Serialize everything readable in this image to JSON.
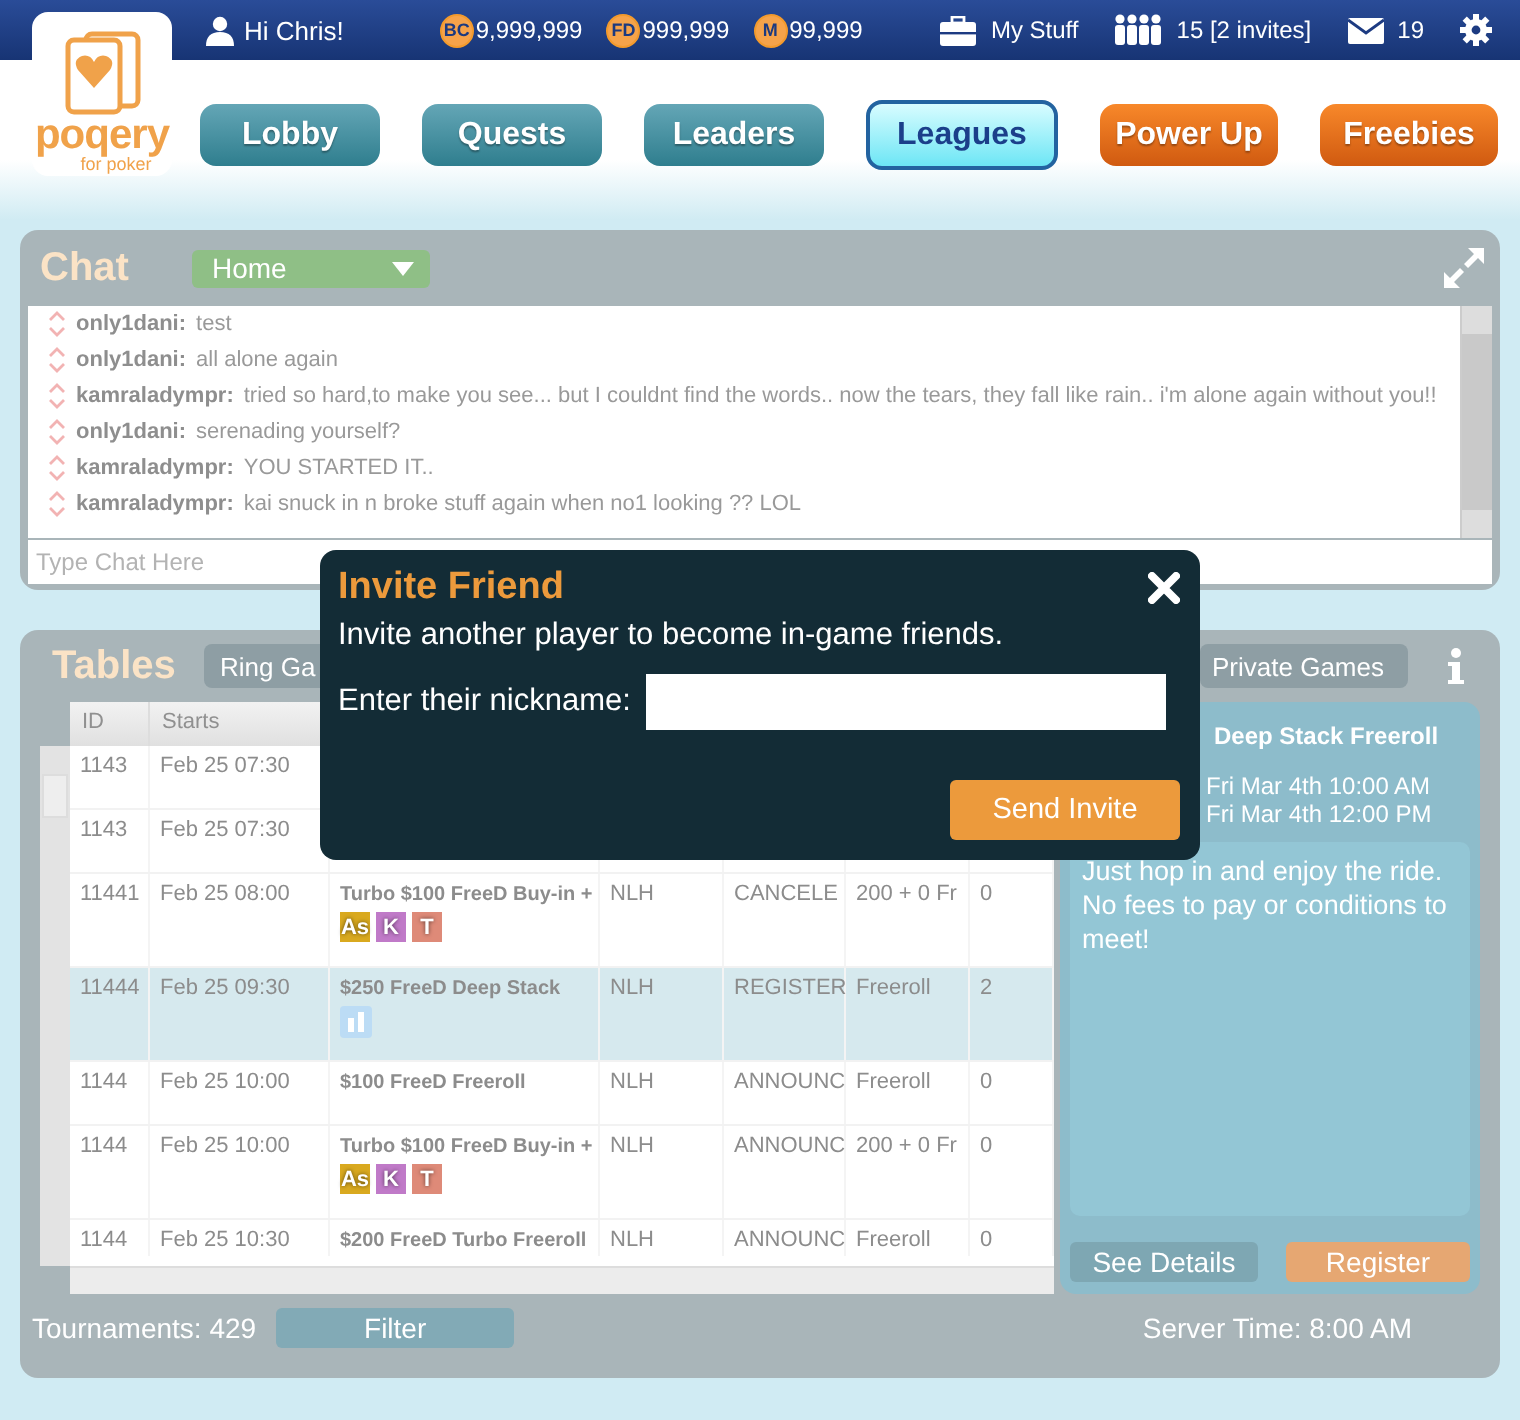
{
  "top_bar": {
    "greeting": "Hi Chris!",
    "currencies": [
      {
        "code": "BC",
        "amount": "9,999,999"
      },
      {
        "code": "FD",
        "amount": "999,999"
      },
      {
        "code": "M",
        "amount": "99,999"
      }
    ],
    "my_stuff": "My Stuff",
    "friends": "15 [2 invites]",
    "messages": "19"
  },
  "logo": {
    "name": "poqery",
    "tagline": "for poker"
  },
  "nav": [
    {
      "label": "Lobby",
      "kind": "standard",
      "selected": false
    },
    {
      "label": "Quests",
      "kind": "standard",
      "selected": false
    },
    {
      "label": "Leaders",
      "kind": "standard",
      "selected": false
    },
    {
      "label": "Leagues",
      "kind": "standard",
      "selected": true
    },
    {
      "label": "Power Up",
      "kind": "promo",
      "selected": false
    },
    {
      "label": "Freebies",
      "kind": "promo",
      "selected": false
    }
  ],
  "chat": {
    "title": "Chat",
    "room": "Home",
    "messages": [
      {
        "user": "only1dani:",
        "text": "test"
      },
      {
        "user": "only1dani:",
        "text": "all alone again"
      },
      {
        "user": "kamraladympr:",
        "text": "tried so hard,to make you see... but I couldnt find the words.. now the tears, they fall like rain.. i'm alone again without you!!"
      },
      {
        "user": "only1dani:",
        "text": "serenading yourself?"
      },
      {
        "user": "kamraladympr:",
        "text": "YOU STARTED IT.."
      },
      {
        "user": "kamraladympr:",
        "text": "kai snuck in n broke stuff again when no1 looking ?? LOL"
      }
    ],
    "placeholder": "Type Chat Here"
  },
  "tables": {
    "title": "Tables",
    "tabs": [
      {
        "label": "Ring Ga",
        "selected": false
      },
      {
        "label": "Private Games",
        "selected": false
      }
    ],
    "columns": [
      "ID",
      "Starts"
    ],
    "rows": [
      {
        "selected": false,
        "cells": [
          "1143",
          "Feb 25 07:30"
        ],
        "badges": []
      },
      {
        "selected": false,
        "cells": [
          "1143",
          "Feb 25 07:30"
        ],
        "badges": []
      },
      {
        "selected": false,
        "cells": [
          "11441",
          "Feb 25 08:00",
          "Turbo $100 FreeD Buy-in +",
          "NLH",
          "CANCELE",
          "200 + 0 Fr",
          "0"
        ],
        "badges": [
          {
            "kind": "letter",
            "label": "As",
            "color": "#d9a91f"
          },
          {
            "kind": "letter",
            "label": "K",
            "color": "#c07ac8"
          },
          {
            "kind": "letter",
            "label": "T",
            "color": "#de8a78"
          }
        ]
      },
      {
        "selected": true,
        "cells": [
          "11444",
          "Feb 25 09:30",
          "$250 FreeD Deep Stack",
          "NLH",
          "REGISTER",
          "Freeroll",
          "2"
        ],
        "badges": [
          {
            "kind": "chart",
            "color": "#bcdcf5"
          }
        ]
      },
      {
        "selected": false,
        "cells": [
          "1144",
          "Feb 25 10:00",
          "$100 FreeD Freeroll",
          "NLH",
          "ANNOUNC",
          "Freeroll",
          "0"
        ],
        "badges": []
      },
      {
        "selected": false,
        "cells": [
          "1144",
          "Feb 25 10:00",
          "Turbo $100 FreeD Buy-in +",
          "NLH",
          "ANNOUNC",
          "200 + 0 Fr",
          "0"
        ],
        "badges": [
          {
            "kind": "letter",
            "label": "As",
            "color": "#d9a91f"
          },
          {
            "kind": "letter",
            "label": "K",
            "color": "#c07ac8"
          },
          {
            "kind": "letter",
            "label": "T",
            "color": "#de8a78"
          }
        ]
      },
      {
        "selected": false,
        "cells": [
          "1144",
          "Feb 25 10:30",
          "$200 FreeD Turbo Freeroll",
          "NLH",
          "ANNOUNC",
          "Freeroll",
          "0"
        ],
        "badges": []
      }
    ],
    "detail": {
      "title": "Deep Stack Freeroll",
      "dates": [
        "Fri Mar 4th 10:00 AM",
        "Fri Mar 4th 12:00 PM"
      ],
      "description": "Just hop in and enjoy the ride. No fees to pay or conditions to meet!",
      "buttons": [
        "See Details",
        "Register"
      ]
    },
    "count": "Tournaments: 429",
    "filter": "Filter",
    "server_time": "Server Time: 8:00 AM"
  },
  "dialog": {
    "title": "Invite Friend",
    "text": "Invite another player to become in-game friends.",
    "label": "Enter their nickname:",
    "button": "Send Invite"
  }
}
